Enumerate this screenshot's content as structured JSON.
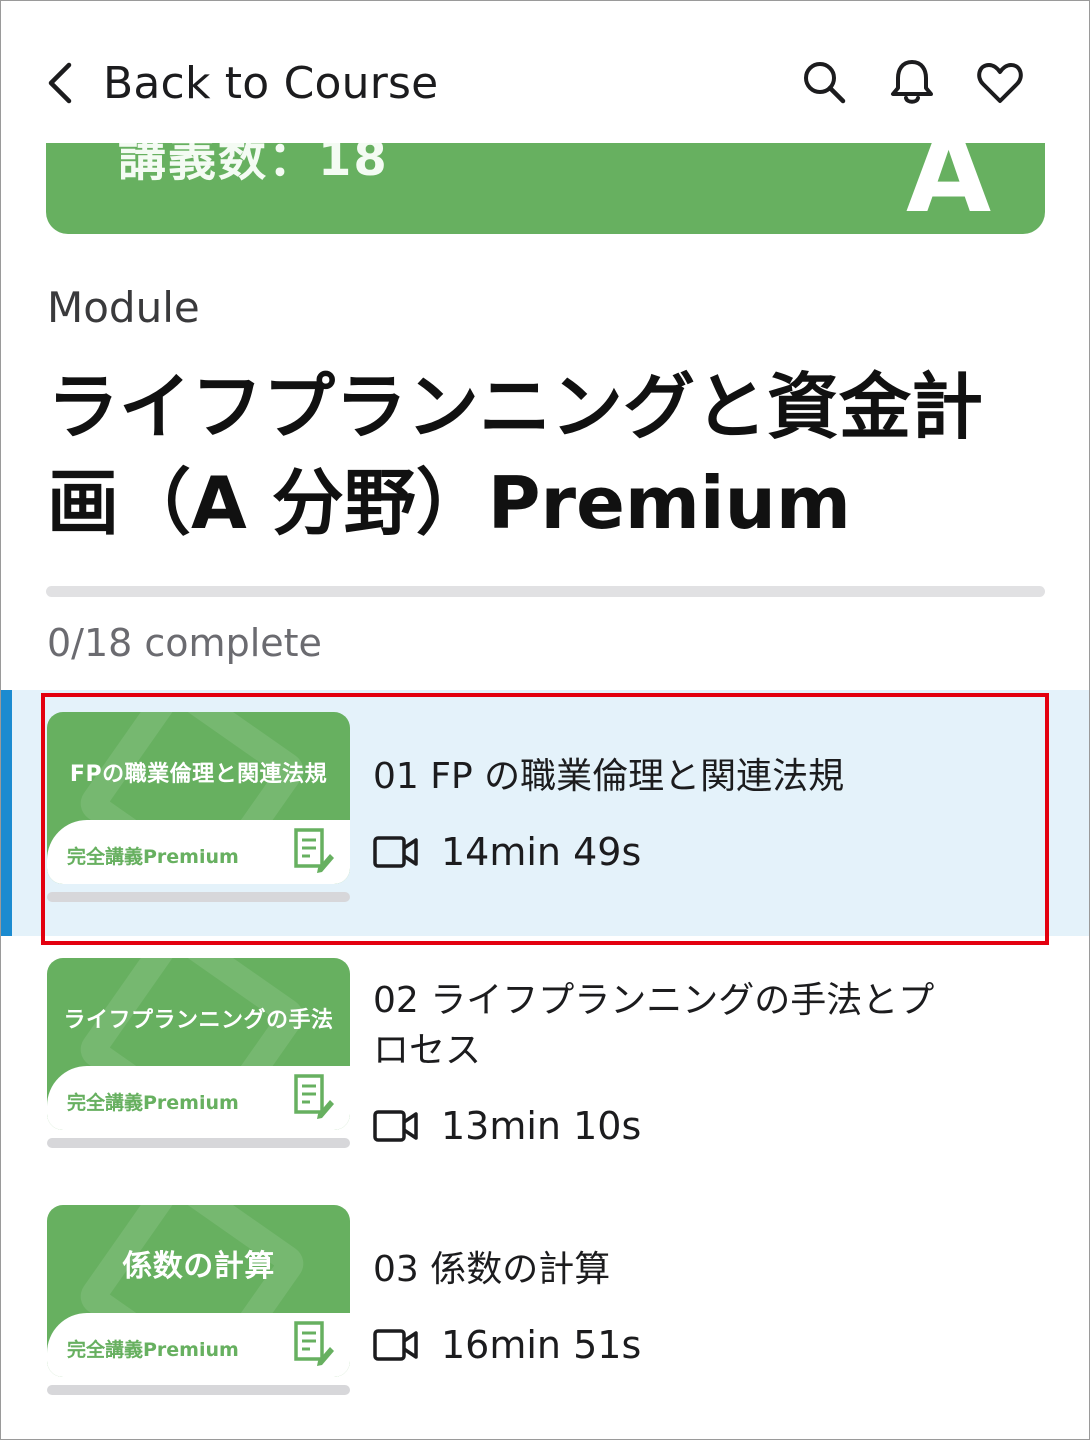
{
  "header": {
    "back_label": "Back to Course",
    "icons": [
      "chevron-left-icon",
      "search-icon",
      "bell-icon",
      "heart-icon"
    ]
  },
  "banner": {
    "text": "講義数：18",
    "letter": "A",
    "color": "#67b060"
  },
  "module": {
    "label": "Module",
    "title": "ライフプランニングと資金計画（A 分野）Premium"
  },
  "progress": {
    "completed": 0,
    "total": 18,
    "text": "0/18 complete"
  },
  "colors": {
    "accent": "#67b060",
    "active_bg": "#e4f2fa",
    "active_bar": "#1b8bd0",
    "highlight": "#e3000f"
  },
  "lessons": [
    {
      "thumb_title": "FPの職業倫理と関連法規",
      "thumb_sub": "完全講義Premium",
      "title": "01 FP の職業倫理と関連法規",
      "duration": "14min 49s",
      "active": true
    },
    {
      "thumb_title": "ライフプランニングの手法",
      "thumb_sub": "完全講義Premium",
      "title": "02 ライフプランニングの手法とプロセス",
      "duration": "13min 10s",
      "active": false
    },
    {
      "thumb_title": "係数の計算",
      "thumb_sub": "完全講義Premium",
      "title": "03 係数の計算",
      "duration": "16min 51s",
      "active": false
    }
  ]
}
